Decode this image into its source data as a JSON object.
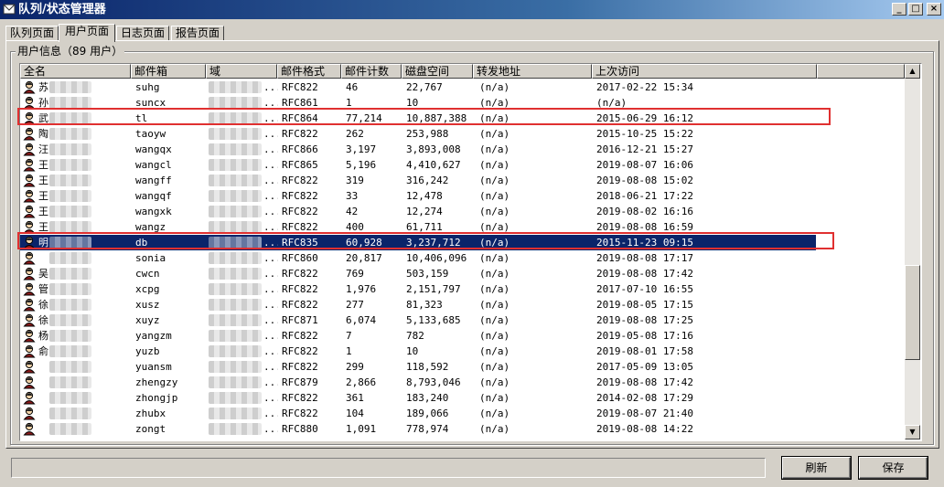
{
  "window": {
    "title": "队列/状态管理器",
    "controls": [
      "_",
      "□",
      "×"
    ]
  },
  "tabs": [
    {
      "label": "队列页面",
      "active": false
    },
    {
      "label": "用户页面",
      "active": true
    },
    {
      "label": "日志页面",
      "active": false
    },
    {
      "label": "报告页面",
      "active": false
    }
  ],
  "group": {
    "label": "用户信息（89 用户）"
  },
  "columns": [
    "全名",
    "邮件箱",
    "域",
    "邮件格式",
    "邮件计数",
    "磁盘空间",
    "转发地址",
    "上次访问"
  ],
  "rows": [
    {
      "name": "苏",
      "mailbox": "suhg",
      "domain": "",
      "format": "RFC822",
      "count": "46",
      "disk": "22,767",
      "forward": "(n/a)",
      "last": "2017-02-22 15:34"
    },
    {
      "name": "孙",
      "mailbox": "suncx",
      "domain": "",
      "format": "RFC861",
      "count": "1",
      "disk": "10",
      "forward": "(n/a)",
      "last": "(n/a)"
    },
    {
      "name": "武",
      "mailbox": "tl",
      "domain": "",
      "format": "RFC864",
      "count": "77,214",
      "disk": "10,887,388",
      "forward": "(n/a)",
      "last": "2015-06-29 16:12",
      "highlight": true
    },
    {
      "name": "陶",
      "mailbox": "taoyw",
      "domain": "",
      "format": "RFC822",
      "count": "262",
      "disk": "253,988",
      "forward": "(n/a)",
      "last": "2015-10-25 15:22"
    },
    {
      "name": "汪",
      "mailbox": "wangqx",
      "domain": "",
      "format": "RFC866",
      "count": "3,197",
      "disk": "3,893,008",
      "forward": "(n/a)",
      "last": "2016-12-21 15:27"
    },
    {
      "name": "王",
      "mailbox": "wangcl",
      "domain": "",
      "format": "RFC865",
      "count": "5,196",
      "disk": "4,410,627",
      "forward": "(n/a)",
      "last": "2019-08-07 16:06"
    },
    {
      "name": "王",
      "mailbox": "wangff",
      "domain": "",
      "format": "RFC822",
      "count": "319",
      "disk": "316,242",
      "forward": "(n/a)",
      "last": "2019-08-08 15:02"
    },
    {
      "name": "王",
      "mailbox": "wangqf",
      "domain": "",
      "format": "RFC822",
      "count": "33",
      "disk": "12,478",
      "forward": "(n/a)",
      "last": "2018-06-21 17:22"
    },
    {
      "name": "王",
      "mailbox": "wangxk",
      "domain": "",
      "format": "RFC822",
      "count": "42",
      "disk": "12,274",
      "forward": "(n/a)",
      "last": "2019-08-02 16:16"
    },
    {
      "name": "王",
      "mailbox": "wangz",
      "domain": "",
      "format": "RFC822",
      "count": "400",
      "disk": "61,711",
      "forward": "(n/a)",
      "last": "2019-08-08 16:59"
    },
    {
      "name": "明",
      "mailbox": "db",
      "domain": "",
      "format": "RFC835",
      "count": "60,928",
      "disk": "3,237,712",
      "forward": "(n/a)",
      "last": "2015-11-23 09:15",
      "selected": true,
      "highlight": true
    },
    {
      "name": "",
      "mailbox": "sonia",
      "domain": "",
      "format": "RFC860",
      "count": "20,817",
      "disk": "10,406,096",
      "forward": "(n/a)",
      "last": "2019-08-08 17:17"
    },
    {
      "name": "吴",
      "mailbox": "cwcn",
      "domain": "",
      "format": "RFC822",
      "count": "769",
      "disk": "503,159",
      "forward": "(n/a)",
      "last": "2019-08-08 17:42"
    },
    {
      "name": "管",
      "mailbox": "xcpg",
      "domain": "",
      "format": "RFC822",
      "count": "1,976",
      "disk": "2,151,797",
      "forward": "(n/a)",
      "last": "2017-07-10 16:55"
    },
    {
      "name": "徐",
      "mailbox": "xusz",
      "domain": "",
      "format": "RFC822",
      "count": "277",
      "disk": "81,323",
      "forward": "(n/a)",
      "last": "2019-08-05 17:15"
    },
    {
      "name": "徐",
      "mailbox": "xuyz",
      "domain": "",
      "format": "RFC871",
      "count": "6,074",
      "disk": "5,133,685",
      "forward": "(n/a)",
      "last": "2019-08-08 17:25"
    },
    {
      "name": "杨",
      "mailbox": "yangzm",
      "domain": "",
      "format": "RFC822",
      "count": "7",
      "disk": "782",
      "forward": "(n/a)",
      "last": "2019-05-08 17:16"
    },
    {
      "name": "俞",
      "mailbox": "yuzb",
      "domain": "",
      "format": "RFC822",
      "count": "1",
      "disk": "10",
      "forward": "(n/a)",
      "last": "2019-08-01 17:58"
    },
    {
      "name": "",
      "mailbox": "yuansm",
      "domain": "",
      "format": "RFC822",
      "count": "299",
      "disk": "118,592",
      "forward": "(n/a)",
      "last": "2017-05-09 13:05"
    },
    {
      "name": "",
      "mailbox": "zhengzy",
      "domain": "",
      "format": "RFC879",
      "count": "2,866",
      "disk": "8,793,046",
      "forward": "(n/a)",
      "last": "2019-08-08 17:42"
    },
    {
      "name": "",
      "mailbox": "zhongjp",
      "domain": "",
      "format": "RFC822",
      "count": "361",
      "disk": "183,240",
      "forward": "(n/a)",
      "last": "2014-02-08 17:29"
    },
    {
      "name": "",
      "mailbox": "zhubx",
      "domain": "",
      "format": "RFC822",
      "count": "104",
      "disk": "189,066",
      "forward": "(n/a)",
      "last": "2019-08-07 21:40"
    },
    {
      "name": "",
      "mailbox": "zongt",
      "domain": "",
      "format": "RFC880",
      "count": "1,091",
      "disk": "778,974",
      "forward": "(n/a)",
      "last": "2019-08-08 14:22"
    }
  ],
  "buttons": {
    "refresh": "刷新",
    "save": "保存"
  },
  "scrollbar": {
    "up_arrow": "▲",
    "down_arrow": "▼",
    "position": 0.74
  },
  "colors": {
    "selection": "#0a246a",
    "highlight_box": "#e03030",
    "face": "#d4d0c8"
  }
}
